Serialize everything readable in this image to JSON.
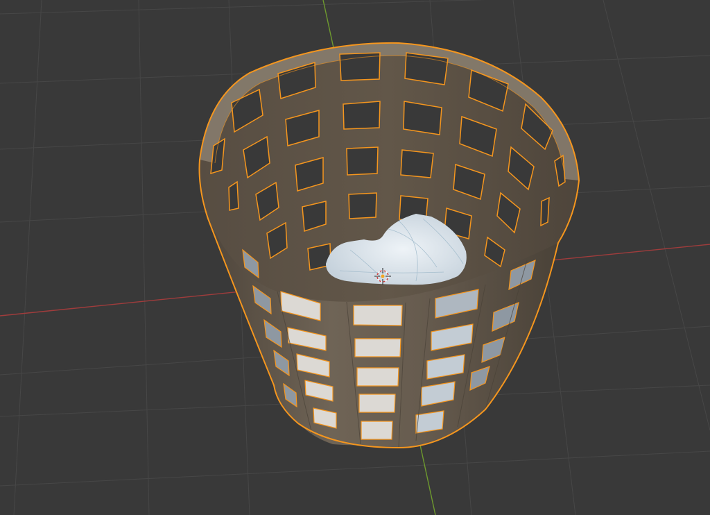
{
  "viewport": {
    "background_color": "#393939",
    "grid_color": "#4a4a4a",
    "x_axis_color": "#a03c3c",
    "y_axis_color": "#6e9a2e"
  },
  "selected_object": {
    "outline_color": "#f5961e",
    "body_color": "#6b6053",
    "inner_color": "#5e5448",
    "rim_color": "#8a7f70"
  },
  "contents": {
    "color": "#dfe7ee"
  },
  "cursor_3d": {
    "icon": "3d-cursor-icon"
  }
}
